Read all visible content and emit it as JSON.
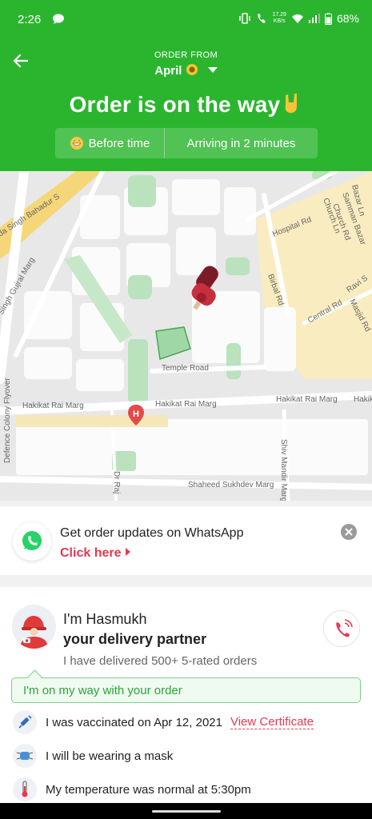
{
  "status_bar": {
    "time": "2:26",
    "speed_value": "17.29",
    "speed_unit": "KB/s",
    "battery": "68%"
  },
  "header": {
    "order_from_label": "ORDER FROM",
    "store_name": "April",
    "title": "Order is on the way",
    "status_before": "Before time",
    "status_arriving": "Arriving in 2 minutes"
  },
  "map": {
    "labels": {
      "road_1": "da Singh Bahadur S",
      "road_2": "Singh Gujral Marg",
      "road_3": "Hospital Rd",
      "road_4": "Birbal Rd",
      "road_5": "Temple Road",
      "road_6": "Hakikat Rai Marg",
      "road_7": "Hakikat Rai Marg",
      "road_8": "Hakikat Rai Marg",
      "road_9": "Hakikat",
      "road_10": "Defence Colony Flyover",
      "road_11": "Central Rd",
      "road_12": "Church Ln",
      "road_13": "Church Rd",
      "road_14": "Samman Bazar",
      "road_15": "Bazar Ln",
      "road_16": "Ravi S",
      "road_17": "Masjid Rd",
      "road_18": "Shaheed Sukhdev Marg",
      "road_19": "Shiv Mandir Marg",
      "road_20": "Dr Raj"
    }
  },
  "whatsapp": {
    "title": "Get order updates on WhatsApp",
    "cta": "Click here"
  },
  "partner": {
    "name_line": "I'm Hasmukh",
    "role_line": "your delivery partner",
    "orders_line": "I have delivered 500+ 5-rated orders",
    "bubble_text": "I'm on my way with your order",
    "safety": [
      {
        "text": "I was vaccinated on Apr 12, 2021",
        "link": "View Certificate",
        "icon": "syringe-icon"
      },
      {
        "text": "I will be wearing a mask",
        "icon": "mask-icon"
      },
      {
        "text": "My temperature was normal at 5:30pm",
        "icon": "thermometer-icon"
      }
    ]
  },
  "colors": {
    "brand_green": "#2bb52f",
    "accent_red": "#e53950"
  }
}
